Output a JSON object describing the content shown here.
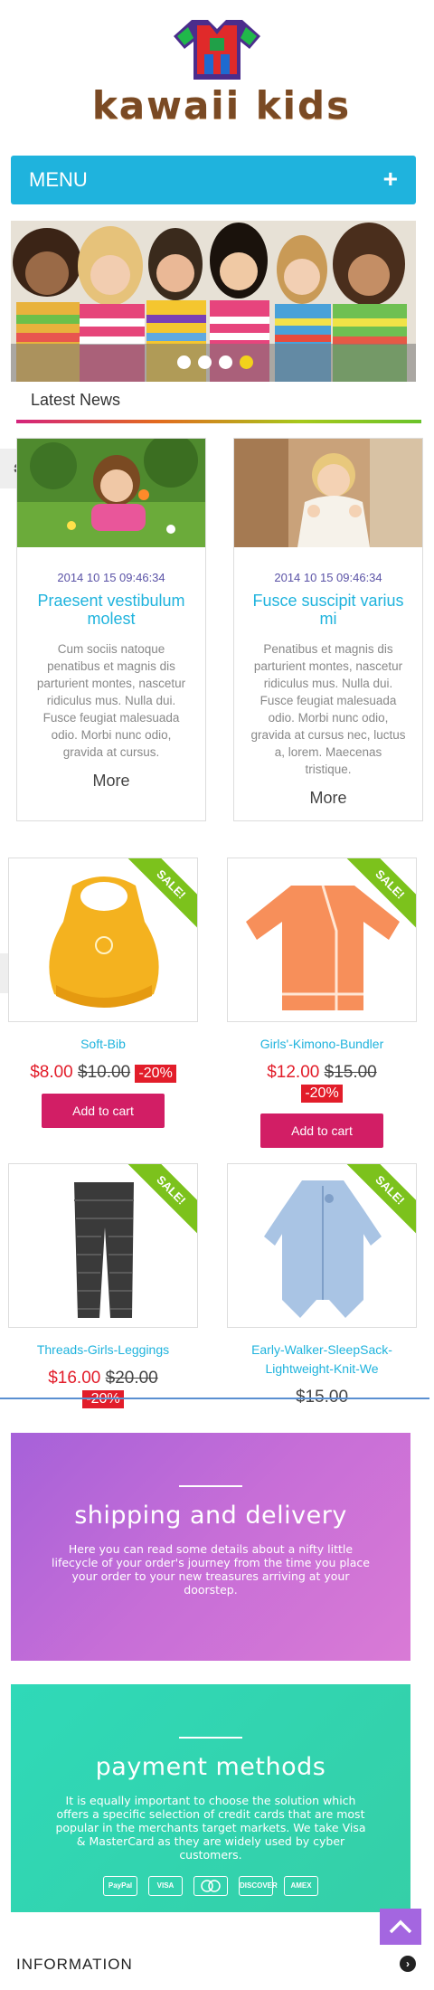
{
  "brand": {
    "name": "kawaii kids"
  },
  "menu": {
    "label": "MENU",
    "toggle": "+"
  },
  "slider": {
    "dot_count": 4,
    "active_dot": 4
  },
  "news": {
    "title": "Latest News",
    "items": [
      {
        "date": "2014 10 15 09:46:34",
        "title": "Praesent vestibulum molest",
        "body": "Cum sociis natoque penatibus et magnis dis parturient montes, nascetur ridiculus mus. Nulla dui. Fusce feugiat malesuada odio. Morbi nunc odio, gravida at cursus.",
        "more": "More"
      },
      {
        "date": "2014 10 15 09:46:34",
        "title": "Fusce suscipit varius mi",
        "body": "Penatibus et magnis dis parturient montes, nascetur ridiculus mus. Nulla dui. Fusce feugiat malesuada odio. Morbi nunc odio, gravida at cursus nec, luctus a, lorem. Maecenas tristique.",
        "more": "More"
      }
    ]
  },
  "products": [
    {
      "name": "Soft-Bib",
      "price": "$8.00",
      "old_price": "$10.00",
      "discount": "-20%",
      "badge": "SALE!",
      "button": "Add to cart"
    },
    {
      "name": "Girls'-Kimono-Bundler",
      "price": "$12.00",
      "old_price": "$15.00",
      "discount": "-20%",
      "badge": "SALE!",
      "button": "Add to cart"
    },
    {
      "name": "Threads-Girls-Leggings",
      "price": "$16.00",
      "old_price": "$20.00",
      "discount": "-20%",
      "badge": "SALE!"
    },
    {
      "name": "Early-Walker-SleepSack-Lightweight-Knit-We",
      "price": "$15.00",
      "badge": "SALE!"
    }
  ],
  "promos": {
    "shipping": {
      "title": "shipping and delivery",
      "text": "Here you can read some details about a nifty little lifecycle of your order's journey from the time you place your order to your new treasures arriving at your doorstep."
    },
    "payment": {
      "title": "payment methods",
      "text": "It is equally important to choose the solution which offers a specific selection of credit cards that are most popular in the merchants target markets. We take Visa & MasterCard as they are widely used by cyber customers.",
      "cards": [
        "PayPal",
        "VISA",
        "",
        "DISCOVER",
        "AMEX"
      ]
    }
  },
  "footer": {
    "information_label": "INFORMATION"
  },
  "colors": {
    "accent": "#1fb3dd",
    "sale_green": "#7cc21c",
    "price_red": "#e21d2a",
    "cart_pink": "#d21e65",
    "shipping_purple": "#b268d8",
    "payment_teal": "#32d4b0",
    "date_purple": "#5a52a6"
  },
  "icons": {
    "logo": "shirt-logo-icon",
    "gear": "gears-icon",
    "back_to_top": "chevron-up-icon",
    "info_toggle": "circle-arrow-icon"
  }
}
